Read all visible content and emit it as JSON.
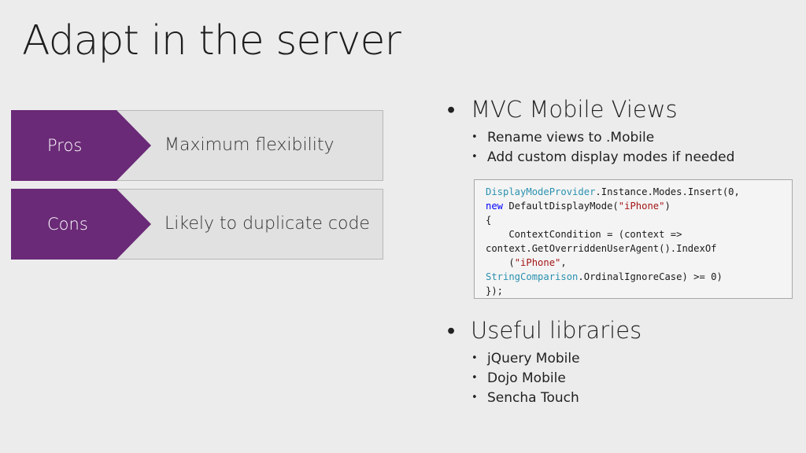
{
  "slide": {
    "title": "Adapt in the server"
  },
  "pros": {
    "label": "Pros",
    "text": "Maximum flexibility"
  },
  "cons": {
    "label": "Cons",
    "text": "Likely to duplicate code"
  },
  "mvc": {
    "heading": "MVC Mobile Views",
    "items": [
      "Rename views to .Mobile",
      "Add custom display modes if needed"
    ]
  },
  "code": {
    "lines": [
      [
        {
          "t": "DisplayModeProvider",
          "c": "type"
        },
        {
          "t": ".Instance.Modes.Insert(0,",
          "c": "plain"
        }
      ],
      [
        {
          "t": "new",
          "c": "kw"
        },
        {
          "t": " DefaultDisplayMode(",
          "c": "plain"
        },
        {
          "t": "\"iPhone\"",
          "c": "str"
        },
        {
          "t": ")",
          "c": "plain"
        }
      ],
      [
        {
          "t": "{",
          "c": "plain"
        }
      ],
      [
        {
          "t": "    ContextCondition = (context =>",
          "c": "plain"
        }
      ],
      [
        {
          "t": "context.GetOverriddenUserAgent().IndexOf",
          "c": "plain"
        }
      ],
      [
        {
          "t": "    (",
          "c": "plain"
        },
        {
          "t": "\"iPhone\"",
          "c": "str"
        },
        {
          "t": ",",
          "c": "plain"
        }
      ],
      [
        {
          "t": "StringComparison",
          "c": "type"
        },
        {
          "t": ".OrdinalIgnoreCase) >= 0)",
          "c": "plain"
        }
      ],
      [
        {
          "t": "});",
          "c": "plain"
        }
      ]
    ]
  },
  "libraries": {
    "heading": "Useful libraries",
    "items": [
      "jQuery Mobile",
      "Dojo Mobile",
      "Sencha Touch"
    ]
  },
  "colors": {
    "accent": "#6a2a77",
    "code_type": "#2b91af",
    "code_keyword": "#0000ff",
    "code_string": "#a31515"
  }
}
